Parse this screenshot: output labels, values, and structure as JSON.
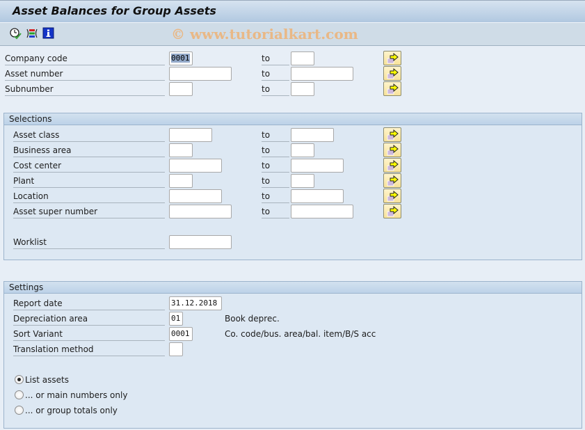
{
  "window": {
    "title": "Asset Balances for Group Assets",
    "watermark": "© www.tutorialkart.com"
  },
  "toolbar": {
    "icons": [
      {
        "name": "execute-clock-icon",
        "tooltip": "Execute"
      },
      {
        "name": "selection-options-icon",
        "tooltip": "Selection options"
      },
      {
        "name": "info-icon",
        "tooltip": "Information"
      }
    ]
  },
  "top_fields": [
    {
      "label": "Company code",
      "from": "0001",
      "to_label": "to",
      "to": ""
    },
    {
      "label": "Asset number",
      "from": "",
      "to_label": "to",
      "to": ""
    },
    {
      "label": "Subnumber",
      "from": "",
      "to_label": "to",
      "to": ""
    }
  ],
  "selections": {
    "title": "Selections",
    "fields": [
      {
        "label": "Asset class",
        "from": "",
        "to_label": "to",
        "to": ""
      },
      {
        "label": "Business area",
        "from": "",
        "to_label": "to",
        "to": ""
      },
      {
        "label": "Cost center",
        "from": "",
        "to_label": "to",
        "to": ""
      },
      {
        "label": "Plant",
        "from": "",
        "to_label": "to",
        "to": ""
      },
      {
        "label": "Location",
        "from": "",
        "to_label": "to",
        "to": ""
      },
      {
        "label": "Asset super number",
        "from": "",
        "to_label": "to",
        "to": ""
      }
    ],
    "worklist": {
      "label": "Worklist",
      "value": ""
    }
  },
  "settings": {
    "title": "Settings",
    "fields": [
      {
        "label": "Report date",
        "value": "31.12.2018",
        "description": ""
      },
      {
        "label": "Depreciation area",
        "value": "01",
        "description": "Book deprec."
      },
      {
        "label": "Sort Variant",
        "value": "0001",
        "description": "Co. code/bus. area/bal. item/B/S acc"
      },
      {
        "label": "Translation method",
        "value": "",
        "description": ""
      }
    ],
    "radios": [
      {
        "label": "List assets",
        "selected": true
      },
      {
        "label": "... or main numbers only",
        "selected": false
      },
      {
        "label": "... or group totals only",
        "selected": false
      }
    ]
  }
}
